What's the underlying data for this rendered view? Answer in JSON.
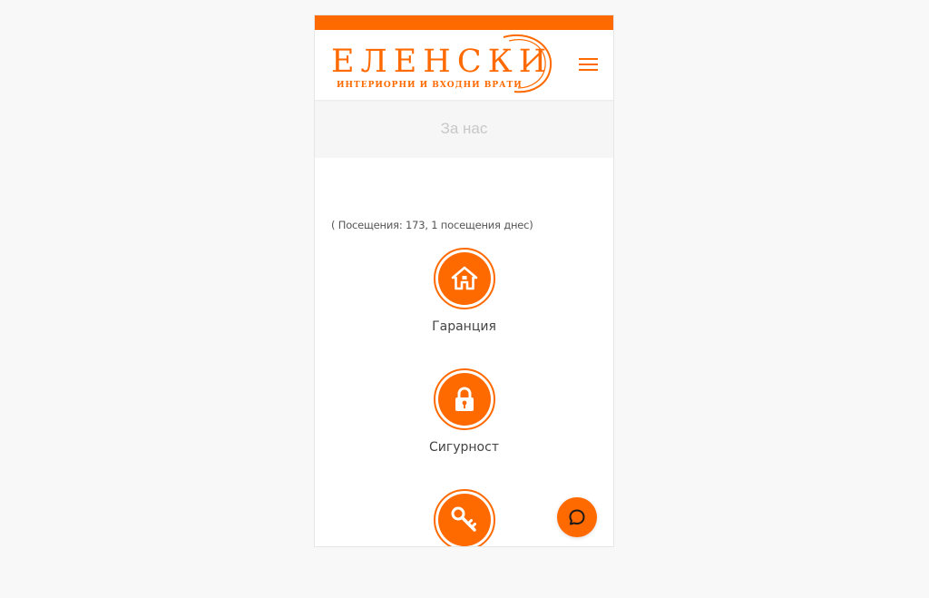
{
  "brand": {
    "name": "ЕЛЕНСКИ",
    "tagline": "ИНТЕРИОРНИ И ВХОДНИ ВРАТИ",
    "accent_color": "#ff6a00"
  },
  "header": {
    "menu_icon": "hamburger-icon"
  },
  "subnav": {
    "title": "За нас"
  },
  "visits": {
    "text": "( Посещения: 173, 1 посещения днес)"
  },
  "features": [
    {
      "label": "Гаранция",
      "icon": "house-icon"
    },
    {
      "label": "Сигурност",
      "icon": "lock-icon"
    },
    {
      "label": "",
      "icon": "key-icon"
    }
  ],
  "chat": {
    "icon": "chat-icon"
  }
}
